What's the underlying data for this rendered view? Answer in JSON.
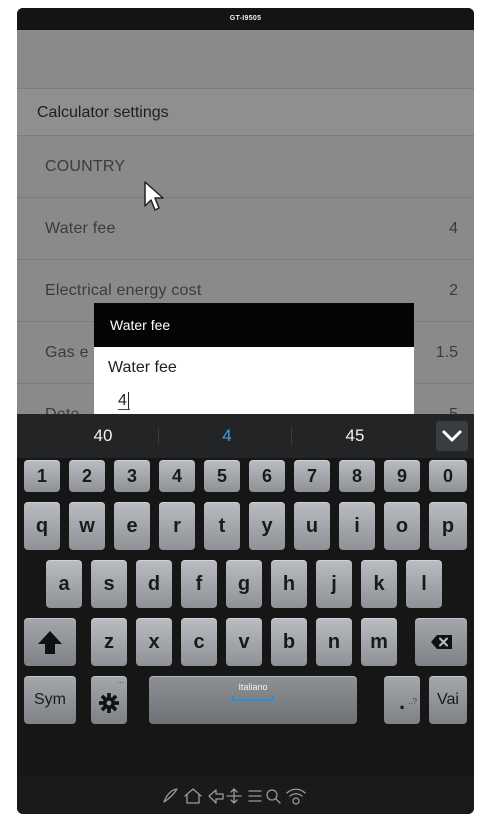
{
  "device": {
    "model": "GT-I9505"
  },
  "settings": {
    "title": "Calculator settings",
    "rows": [
      {
        "label": "COUNTRY",
        "value": ""
      },
      {
        "label": "Water fee",
        "value": "4"
      },
      {
        "label": "Electrical energy cost",
        "value": "2"
      },
      {
        "label": "Gas e",
        "value": "1.5"
      },
      {
        "label": "Dete",
        "value": "5"
      }
    ]
  },
  "dialog": {
    "title": "Water fee",
    "prompt": "Water fee",
    "input_value": "4"
  },
  "suggestions": {
    "items": [
      "40",
      "4",
      "45"
    ],
    "highlight_color": "#3aa0e8"
  },
  "keyboard": {
    "number_row": [
      "1",
      "2",
      "3",
      "4",
      "5",
      "6",
      "7",
      "8",
      "9",
      "0"
    ],
    "row1": [
      "q",
      "w",
      "e",
      "r",
      "t",
      "y",
      "u",
      "i",
      "o",
      "p"
    ],
    "row2": [
      "a",
      "s",
      "d",
      "f",
      "g",
      "h",
      "j",
      "k",
      "l"
    ],
    "row3": [
      "z",
      "x",
      "c",
      "v",
      "b",
      "n",
      "m"
    ],
    "sym": "Sym",
    "space_language": "Italiano",
    "period": ".",
    "action": "Vai",
    "settings_hint": "...",
    "period_hint": "..?"
  },
  "icons": {
    "shift": "shift-arrow-icon",
    "backspace": "backspace-icon",
    "settings": "gear-icon",
    "collapse": "chevron-down-icon"
  }
}
